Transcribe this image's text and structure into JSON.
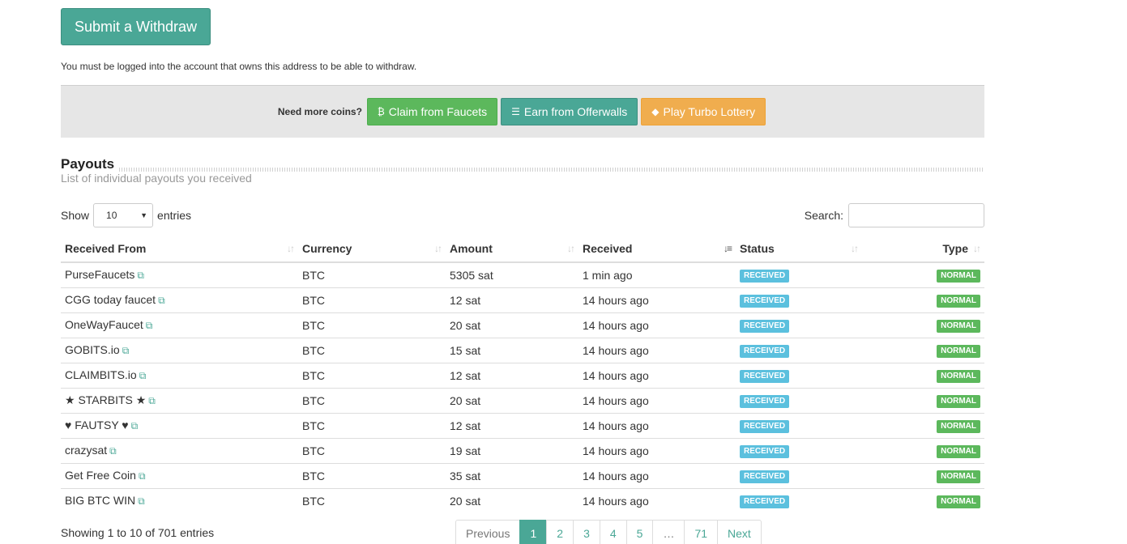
{
  "submit_button": "Submit a Withdraw",
  "notice": "You must be logged into the account that owns this address to be able to withdraw.",
  "coins_bar": {
    "label": "Need more coins?",
    "buttons": [
      {
        "label": "Claim from Faucets",
        "icon": "bitcoin-icon",
        "color": "#5cb85c"
      },
      {
        "label": "Earn from Offerwalls",
        "icon": "list-icon",
        "color": "#4aa796"
      },
      {
        "label": "Play Turbo Lottery",
        "icon": "ticket-icon",
        "color": "#f0ad4e"
      }
    ]
  },
  "section": {
    "title": "Payouts",
    "subtitle": "List of individual payouts you received"
  },
  "length_control": {
    "show_label": "Show",
    "value": "10",
    "entries_label": "entries"
  },
  "search": {
    "label": "Search:",
    "value": ""
  },
  "table": {
    "headers": [
      "Received From",
      "Currency",
      "Amount",
      "Received",
      "Status",
      "Type"
    ],
    "sorted_column": "Received",
    "rows": [
      {
        "from": "PurseFaucets",
        "currency": "BTC",
        "amount": "5305 sat",
        "received": "1 min ago",
        "status": "RECEIVED",
        "type": "NORMAL"
      },
      {
        "from": "CGG today faucet",
        "currency": "BTC",
        "amount": "12 sat",
        "received": "14 hours ago",
        "status": "RECEIVED",
        "type": "NORMAL"
      },
      {
        "from": "OneWayFaucet",
        "currency": "BTC",
        "amount": "20 sat",
        "received": "14 hours ago",
        "status": "RECEIVED",
        "type": "NORMAL"
      },
      {
        "from": "GOBITS.io",
        "currency": "BTC",
        "amount": "15 sat",
        "received": "14 hours ago",
        "status": "RECEIVED",
        "type": "NORMAL"
      },
      {
        "from": "CLAIMBITS.io",
        "currency": "BTC",
        "amount": "12 sat",
        "received": "14 hours ago",
        "status": "RECEIVED",
        "type": "NORMAL"
      },
      {
        "from": "★ STARBITS ★",
        "currency": "BTC",
        "amount": "20 sat",
        "received": "14 hours ago",
        "status": "RECEIVED",
        "type": "NORMAL"
      },
      {
        "from": "♥ FAUTSY ♥",
        "currency": "BTC",
        "amount": "12 sat",
        "received": "14 hours ago",
        "status": "RECEIVED",
        "type": "NORMAL"
      },
      {
        "from": "crazysat",
        "currency": "BTC",
        "amount": "19 sat",
        "received": "14 hours ago",
        "status": "RECEIVED",
        "type": "NORMAL"
      },
      {
        "from": "Get Free Coin",
        "currency": "BTC",
        "amount": "35 sat",
        "received": "14 hours ago",
        "status": "RECEIVED",
        "type": "NORMAL"
      },
      {
        "from": "BIG BTC WIN",
        "currency": "BTC",
        "amount": "20 sat",
        "received": "14 hours ago",
        "status": "RECEIVED",
        "type": "NORMAL"
      }
    ]
  },
  "info": "Showing 1 to 10 of 701 entries",
  "pagination": {
    "previous": "Previous",
    "pages": [
      "1",
      "2",
      "3",
      "4",
      "5",
      "…",
      "71"
    ],
    "active": "1",
    "next": "Next"
  },
  "colors": {
    "accent": "#4aa796",
    "received_badge": "#5bc0de",
    "normal_badge": "#5cb85c"
  }
}
